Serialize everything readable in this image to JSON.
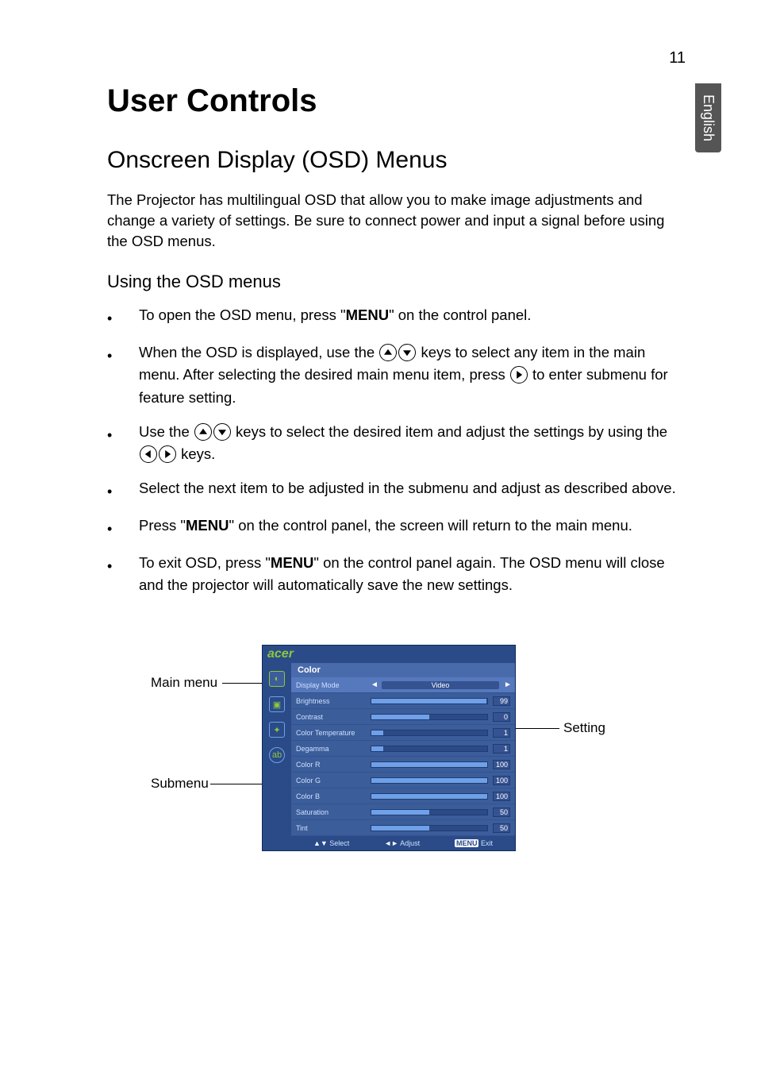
{
  "page_number": "11",
  "lang_tab": "English",
  "h1": "User Controls",
  "h2": "Onscreen Display (OSD) Menus",
  "intro": "The Projector has multilingual OSD that allow you to make image adjustments and change a variety of settings. Be sure to connect power and input a signal before using the OSD menus.",
  "h3": "Using the OSD menus",
  "menu_word": "MENU",
  "bullets": {
    "b1_a": "To open the OSD menu, press \"",
    "b1_b": "\" on the control panel.",
    "b2_a": "When the OSD is displayed, use the ",
    "b2_b": " keys to select any item in the main menu. After selecting the desired main menu item, press ",
    "b2_c": " to enter submenu for feature setting.",
    "b3_a": "Use the ",
    "b3_b": " keys to select the desired item and adjust the settings by using the ",
    "b3_c": " keys.",
    "b4": "Select the next item to be adjusted in the submenu and adjust as described above.",
    "b5_a": "Press \"",
    "b5_b": "\" on the control panel, the screen will return to the main menu.",
    "b6_a": "To exit OSD, press \"",
    "b6_b": "\" on the control panel again. The OSD menu will close and the projector will automatically save the new settings."
  },
  "osd": {
    "logo": "acer",
    "title": "Color",
    "mode_label": "Display Mode",
    "mode_value": "Video",
    "rows": [
      {
        "label": "Brightness",
        "value": "99",
        "fill": 99
      },
      {
        "label": "Contrast",
        "value": "0",
        "fill": 50
      },
      {
        "label": "Color Temperature",
        "value": "1",
        "fill": 10
      },
      {
        "label": "Degamma",
        "value": "1",
        "fill": 10
      },
      {
        "label": "Color R",
        "value": "100",
        "fill": 100
      },
      {
        "label": "Color G",
        "value": "100",
        "fill": 100
      },
      {
        "label": "Color B",
        "value": "100",
        "fill": 100
      },
      {
        "label": "Saturation",
        "value": "50",
        "fill": 50
      },
      {
        "label": "Tint",
        "value": "50",
        "fill": 50
      }
    ],
    "footer_select": "Select",
    "footer_adjust": "Adjust",
    "footer_menu": "MENU",
    "footer_exit": "Exit"
  },
  "callouts": {
    "main_menu": "Main menu",
    "submenu": "Submenu",
    "setting": "Setting"
  }
}
